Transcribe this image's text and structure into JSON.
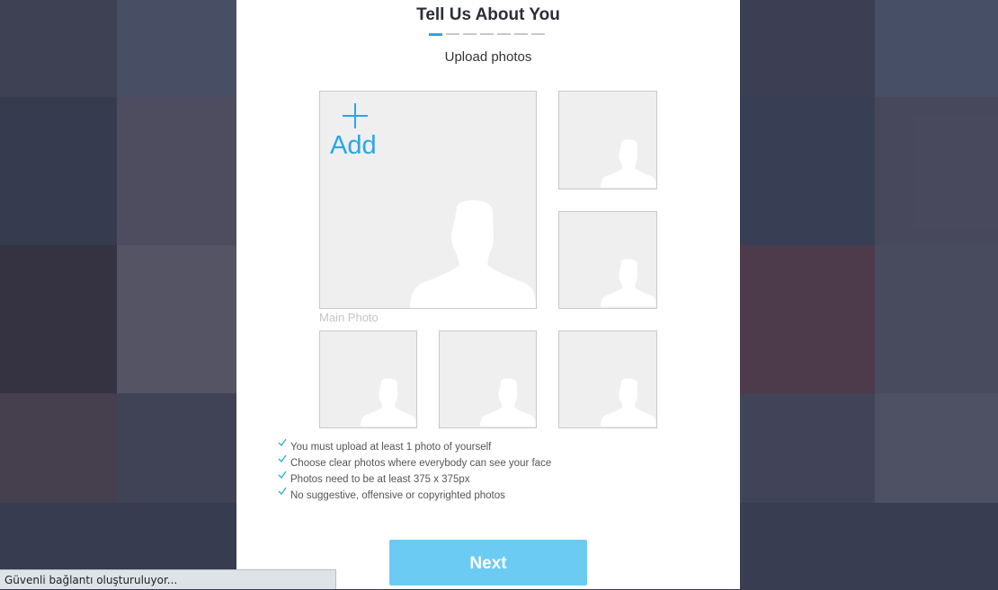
{
  "page": {
    "title": "Tell Us About You",
    "subtitle": "Upload photos",
    "progress": {
      "total_steps": 7,
      "current_step": 1
    }
  },
  "upload": {
    "add_label": "Add",
    "main_photo_label": "Main Photo"
  },
  "rules": [
    "You must upload at least 1 photo of yourself",
    "Choose clear photos where everybody can see your face",
    "Photos need to be at least 375 x 375px",
    "No suggestive, offensive or copyrighted photos"
  ],
  "actions": {
    "next_label": "Next"
  },
  "browser": {
    "status_text": "Güvenli bağlantı oluşturuluyor..."
  },
  "colors": {
    "accent": "#2aa6e6",
    "button": "#6ccbf3",
    "slot_bg": "#efefef"
  }
}
